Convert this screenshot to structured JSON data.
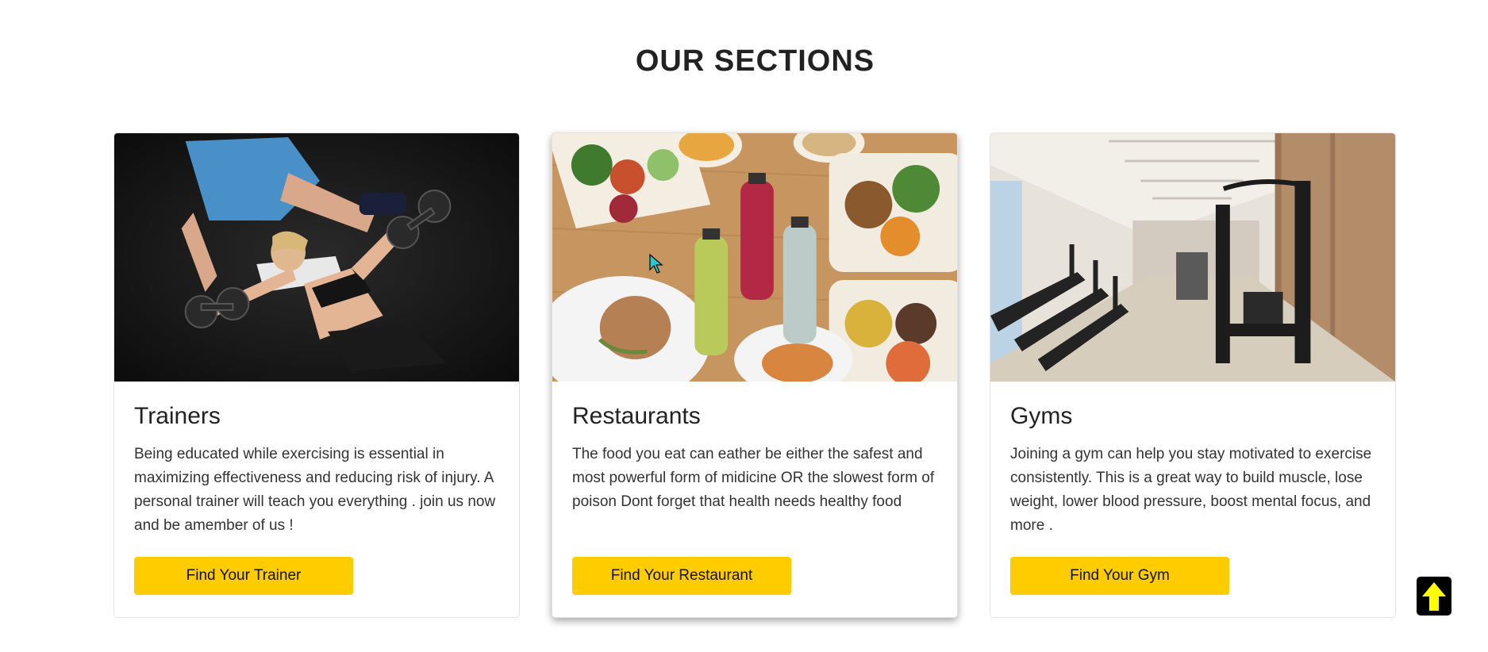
{
  "section": {
    "title": "OUR SECTIONS"
  },
  "cards": [
    {
      "title": "Trainers",
      "text": "Being educated while exercising is essential in maximizing effectiveness and reducing risk of injury. A personal trainer will teach you everything . join us now and be amember of us !",
      "button": "Find Your Trainer",
      "image_icon": "trainer-photo"
    },
    {
      "title": "Restaurants",
      "text": "The food you eat can eather be either the safest and most powerful form of midicine OR the slowest form of poison Dont forget that health needs healthy food",
      "button": "Find Your Restaurant",
      "image_icon": "food-photo"
    },
    {
      "title": "Gyms",
      "text": "Joining a gym can help you stay motivated to exercise consistently. This is a great way to build muscle, lose weight, lower blood pressure, boost mental focus, and more .",
      "button": "Find Your Gym",
      "image_icon": "gym-photo"
    }
  ],
  "scroll_top": {
    "icon": "arrow-up-icon",
    "color": "#ffff00"
  },
  "colors": {
    "accent": "#ffcc00",
    "text": "#222222"
  }
}
